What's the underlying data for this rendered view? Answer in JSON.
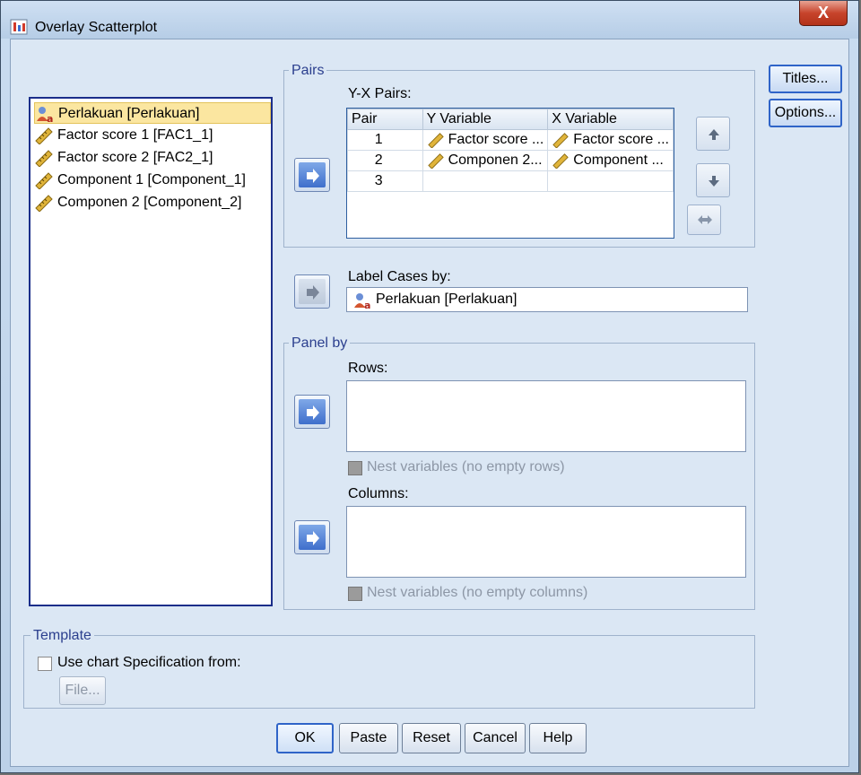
{
  "window": {
    "title": "Overlay Scatterplot",
    "close_label": "X"
  },
  "variables": [
    {
      "label": "Perlakuan [Perlakuan]",
      "icon": "nominal-variable-icon",
      "selected": true
    },
    {
      "label": "Factor score   1 [FAC1_1]",
      "icon": "scale-variable-icon"
    },
    {
      "label": "Factor score   2 [FAC2_1]",
      "icon": "scale-variable-icon"
    },
    {
      "label": "Component 1 [Component_1]",
      "icon": "scale-variable-icon"
    },
    {
      "label": "Componen 2 [Component_2]",
      "icon": "scale-variable-icon"
    }
  ],
  "pairs": {
    "group_label": "Pairs",
    "list_label": "Y-X Pairs:",
    "columns": [
      "Pair",
      "Y Variable",
      "X Variable"
    ],
    "rows": [
      {
        "pair": "1",
        "y": "Factor score ...",
        "x": "Factor score ..."
      },
      {
        "pair": "2",
        "y": "Componen 2...",
        "x": "Component ..."
      },
      {
        "pair": "3",
        "y": "",
        "x": ""
      }
    ]
  },
  "label_cases": {
    "label": "Label Cases by:",
    "value": "Perlakuan [Perlakuan]"
  },
  "panel_by": {
    "group_label": "Panel by",
    "rows_label": "Rows:",
    "nest_rows_label": "Nest variables (no empty rows)",
    "columns_label": "Columns:",
    "nest_columns_label": "Nest variables (no empty columns)"
  },
  "template": {
    "group_label": "Template",
    "use_spec_label": "Use chart Specification from:",
    "file_button": "File..."
  },
  "side_buttons": {
    "titles": "Titles...",
    "options": "Options..."
  },
  "buttons": {
    "ok": "OK",
    "paste": "Paste",
    "reset": "Reset",
    "cancel": "Cancel",
    "help": "Help"
  }
}
